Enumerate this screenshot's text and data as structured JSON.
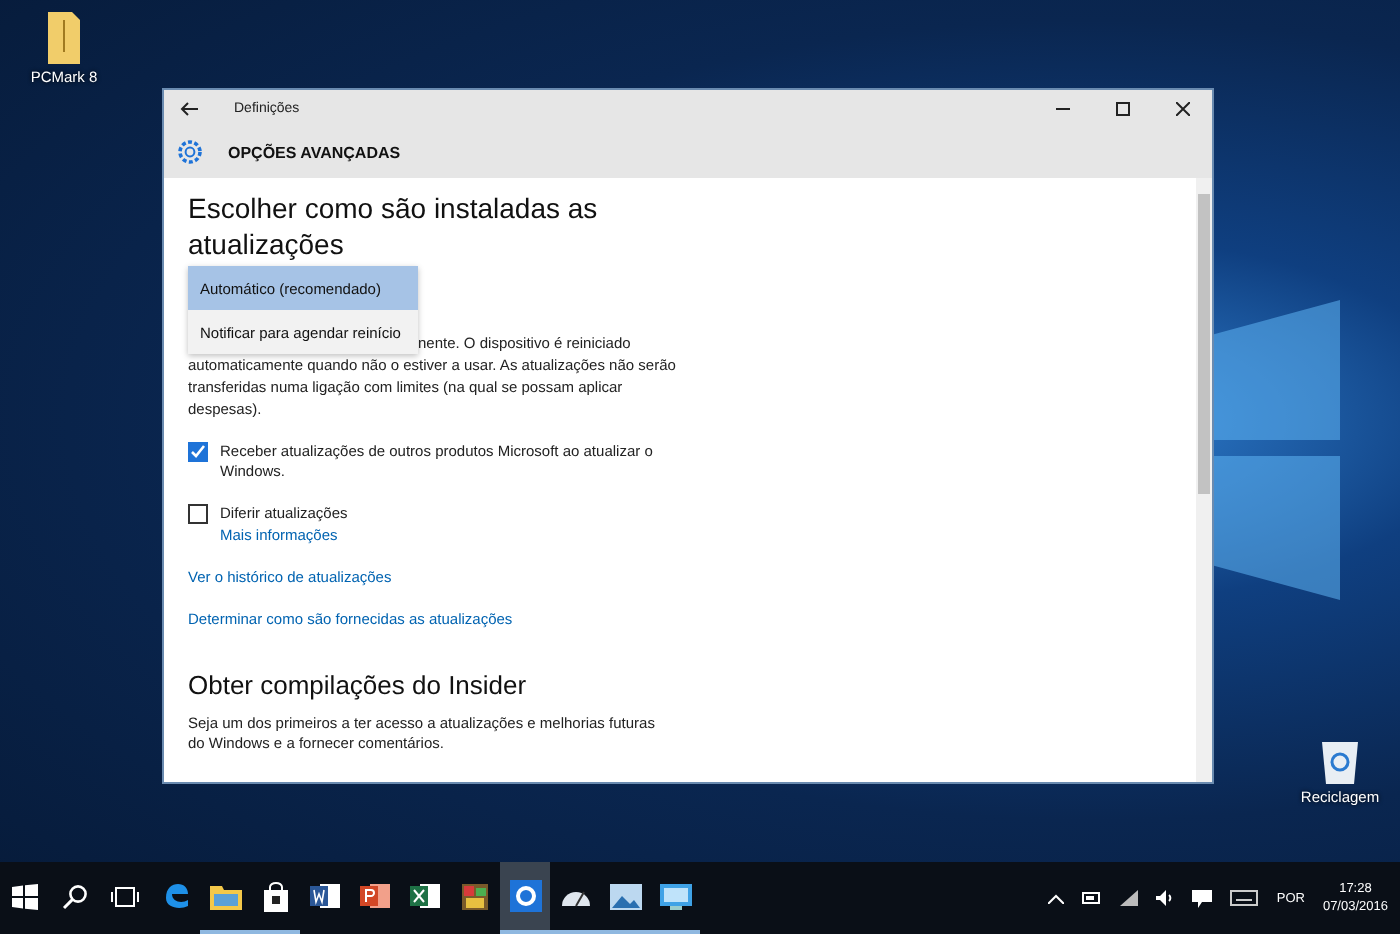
{
  "desktop_icons": [
    {
      "kind": "folder",
      "label": "PCMark 8"
    },
    {
      "kind": "recycle-bin",
      "label": "Reciclagem"
    }
  ],
  "window": {
    "title": "Definições",
    "page_title": "OPÇÕES AVANÇADAS"
  },
  "content": {
    "heading": "Escolher como são instaladas as atualizações",
    "dropdown_options": [
      {
        "label": "Automático (recomendado)",
        "selected": true
      },
      {
        "label": "Notificar para agendar reinício",
        "selected": false
      }
    ],
    "description_fragment": "nente. O dispositivo é reiniciado",
    "description": "automaticamente quando não o estiver a usar. As atualizações não serão transferidas numa ligação com limites (na qual se possam aplicar despesas).",
    "checkboxes": [
      {
        "label": "Receber atualizações de outros produtos Microsoft ao atualizar o Windows.",
        "checked": true
      },
      {
        "label": "Diferir atualizações",
        "checked": false,
        "link": "Mais informações"
      }
    ],
    "links": [
      "Ver o histórico de atualizações",
      "Determinar como são fornecidas as atualizações"
    ],
    "section_heading": "Obter compilações do Insider",
    "section_text": "Seja um dos primeiros a ter acesso a atualizações e melhorias futuras do Windows e a fornecer comentários."
  },
  "taskbar": {
    "items": [
      {
        "kind": "start",
        "running": false,
        "selected": false
      },
      {
        "kind": "search",
        "running": false,
        "selected": false
      },
      {
        "kind": "taskview",
        "running": false,
        "selected": false
      },
      {
        "kind": "edge",
        "running": false,
        "selected": false
      },
      {
        "kind": "explorer",
        "running": true,
        "selected": false
      },
      {
        "kind": "store",
        "running": true,
        "selected": false
      },
      {
        "kind": "word",
        "running": false,
        "selected": false
      },
      {
        "kind": "powerpoint",
        "running": false,
        "selected": false
      },
      {
        "kind": "excel",
        "running": false,
        "selected": false
      },
      {
        "kind": "game",
        "running": false,
        "selected": false
      },
      {
        "kind": "settings",
        "running": true,
        "selected": true
      },
      {
        "kind": "benchmark",
        "running": true,
        "selected": false
      },
      {
        "kind": "photos",
        "running": true,
        "selected": false
      },
      {
        "kind": "monitor",
        "running": true,
        "selected": false
      }
    ],
    "language": "POR",
    "time": "17:28",
    "date": "07/03/2016"
  }
}
